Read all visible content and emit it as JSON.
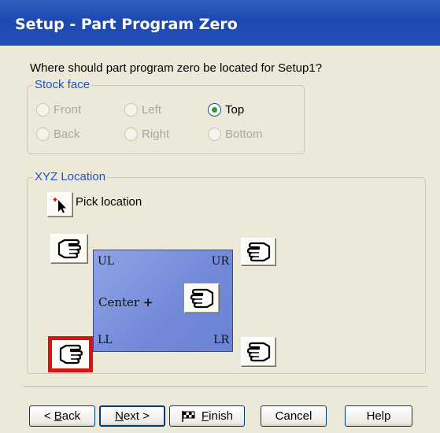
{
  "window": {
    "title": "Setup - Part Program Zero"
  },
  "question": "Where should part program zero be located for Setup1?",
  "stock_face": {
    "legend": "Stock face",
    "options": [
      {
        "label": "Front",
        "enabled": false,
        "selected": false
      },
      {
        "label": "Left",
        "enabled": false,
        "selected": false
      },
      {
        "label": "Top",
        "enabled": true,
        "selected": true
      },
      {
        "label": "Back",
        "enabled": false,
        "selected": false
      },
      {
        "label": "Right",
        "enabled": false,
        "selected": false
      },
      {
        "label": "Bottom",
        "enabled": false,
        "selected": false
      }
    ]
  },
  "xyz": {
    "legend": "XYZ Location",
    "pick_label": "Pick location",
    "corners": {
      "ul": "UL",
      "ur": "UR",
      "ll": "LL",
      "lr": "LR"
    },
    "center_label": "Center",
    "selected_corner": "LL",
    "highlight_color": "#e01010"
  },
  "buttons": {
    "back": {
      "prefix": "< ",
      "key": "B",
      "rest": "ack"
    },
    "next": {
      "key": "N",
      "rest": "ext >"
    },
    "finish": {
      "key": "F",
      "rest": "inish"
    },
    "cancel": "Cancel",
    "help": "Help"
  }
}
